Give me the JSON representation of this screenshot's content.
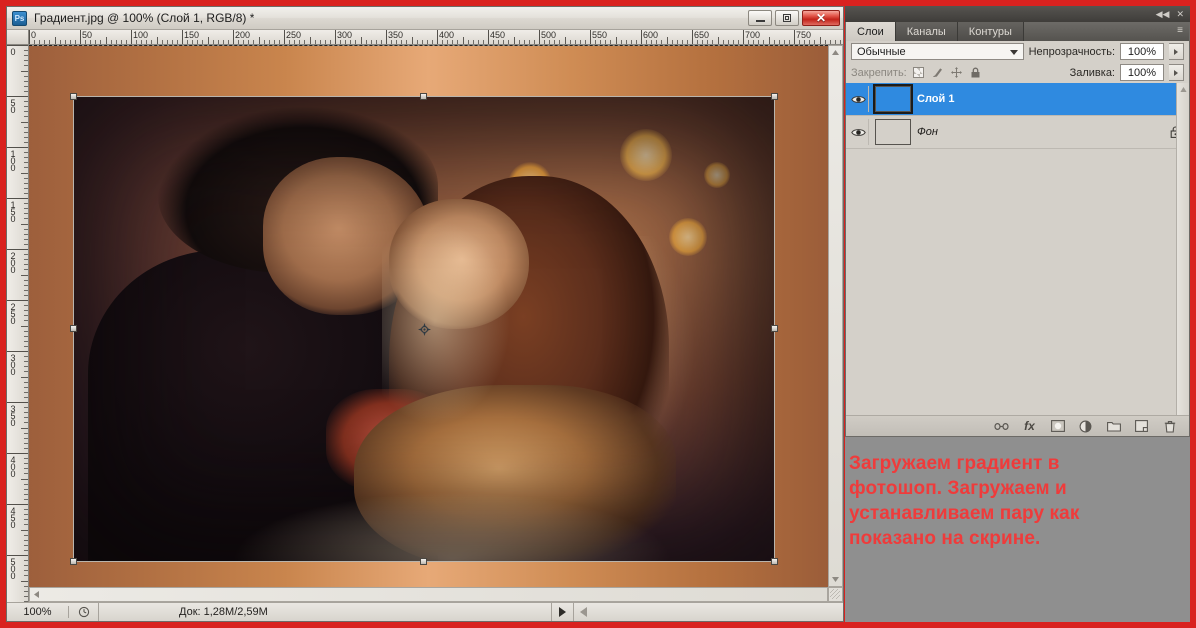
{
  "app": {
    "logo_label": "Ps"
  },
  "document_window": {
    "title": "Градиент.jpg @ 100% (Слой 1, RGB/8) *",
    "window_controls": [
      {
        "name": "minimize",
        "label": "Свернуть"
      },
      {
        "name": "restore",
        "label": "Восстановить"
      },
      {
        "name": "close",
        "label": "Закрыть",
        "glyph": "✕",
        "color": "#c2231a"
      }
    ],
    "rulers": {
      "unit_step": 50,
      "horizontal_labels": [
        "0",
        "50",
        "100",
        "150",
        "200",
        "250",
        "300",
        "350",
        "400",
        "450",
        "500",
        "550",
        "600",
        "650",
        "700",
        "750"
      ],
      "vertical_labels": [
        "0",
        "50",
        "100",
        "150",
        "200",
        "250",
        "300",
        "350",
        "400",
        "450",
        "500"
      ],
      "pixels_per_unit": 1.02
    },
    "canvas": {
      "background_gradient": [
        "#9d5f3c",
        "#e7a977",
        "#9b5d39"
      ],
      "selection": {
        "active": true,
        "handles": 8,
        "reference_point": "center"
      }
    },
    "status_bar": {
      "zoom": "100%",
      "clock_icon": "clock-icon",
      "doc_label": "Док: 1,28M/2,59M",
      "play_glyph": "▶"
    }
  },
  "layers_panel": {
    "topbar_icons": [
      "collapse-icon",
      "close-icon"
    ],
    "collapse_glyph": "◀◀",
    "close_glyph": "✕",
    "menu_glyph": "≡",
    "tabs": [
      {
        "label": "Слои",
        "active": true
      },
      {
        "label": "Каналы",
        "active": false
      },
      {
        "label": "Контуры",
        "active": false
      }
    ],
    "blend_mode": {
      "value": "Обычные"
    },
    "opacity": {
      "label": "Непрозрачность:",
      "value": "100%"
    },
    "lock": {
      "label": "Закрепить:",
      "icons": [
        "lock-transparency-icon",
        "lock-image-icon",
        "lock-position-icon",
        "lock-all-icon"
      ]
    },
    "fill": {
      "label": "Заливка:",
      "value": "100%"
    },
    "layers": [
      {
        "name": "Слой 1",
        "selected": true,
        "visible": true,
        "thumb": "photo",
        "locked": false,
        "italic": false
      },
      {
        "name": "Фон",
        "selected": false,
        "visible": true,
        "thumb": "gradient",
        "locked": true,
        "italic": true
      }
    ],
    "footer_icons": [
      {
        "name": "link-layers-icon",
        "glyph": "⚭"
      },
      {
        "name": "layer-style-fx-icon",
        "glyph": "fx"
      },
      {
        "name": "layer-mask-icon",
        "glyph": "◉"
      },
      {
        "name": "adjustment-layer-icon",
        "glyph": "◑"
      },
      {
        "name": "new-group-icon",
        "glyph": "▭"
      },
      {
        "name": "new-layer-icon",
        "glyph": "⧉"
      },
      {
        "name": "delete-layer-icon",
        "glyph": "Ὕ1"
      }
    ]
  },
  "annotation": {
    "color": "#ef3b3b",
    "lines": [
      "Загружаем градиент в",
      "фотошоп. Загружаем и",
      "устанавливаем пару как",
      "показано на скрине."
    ]
  }
}
